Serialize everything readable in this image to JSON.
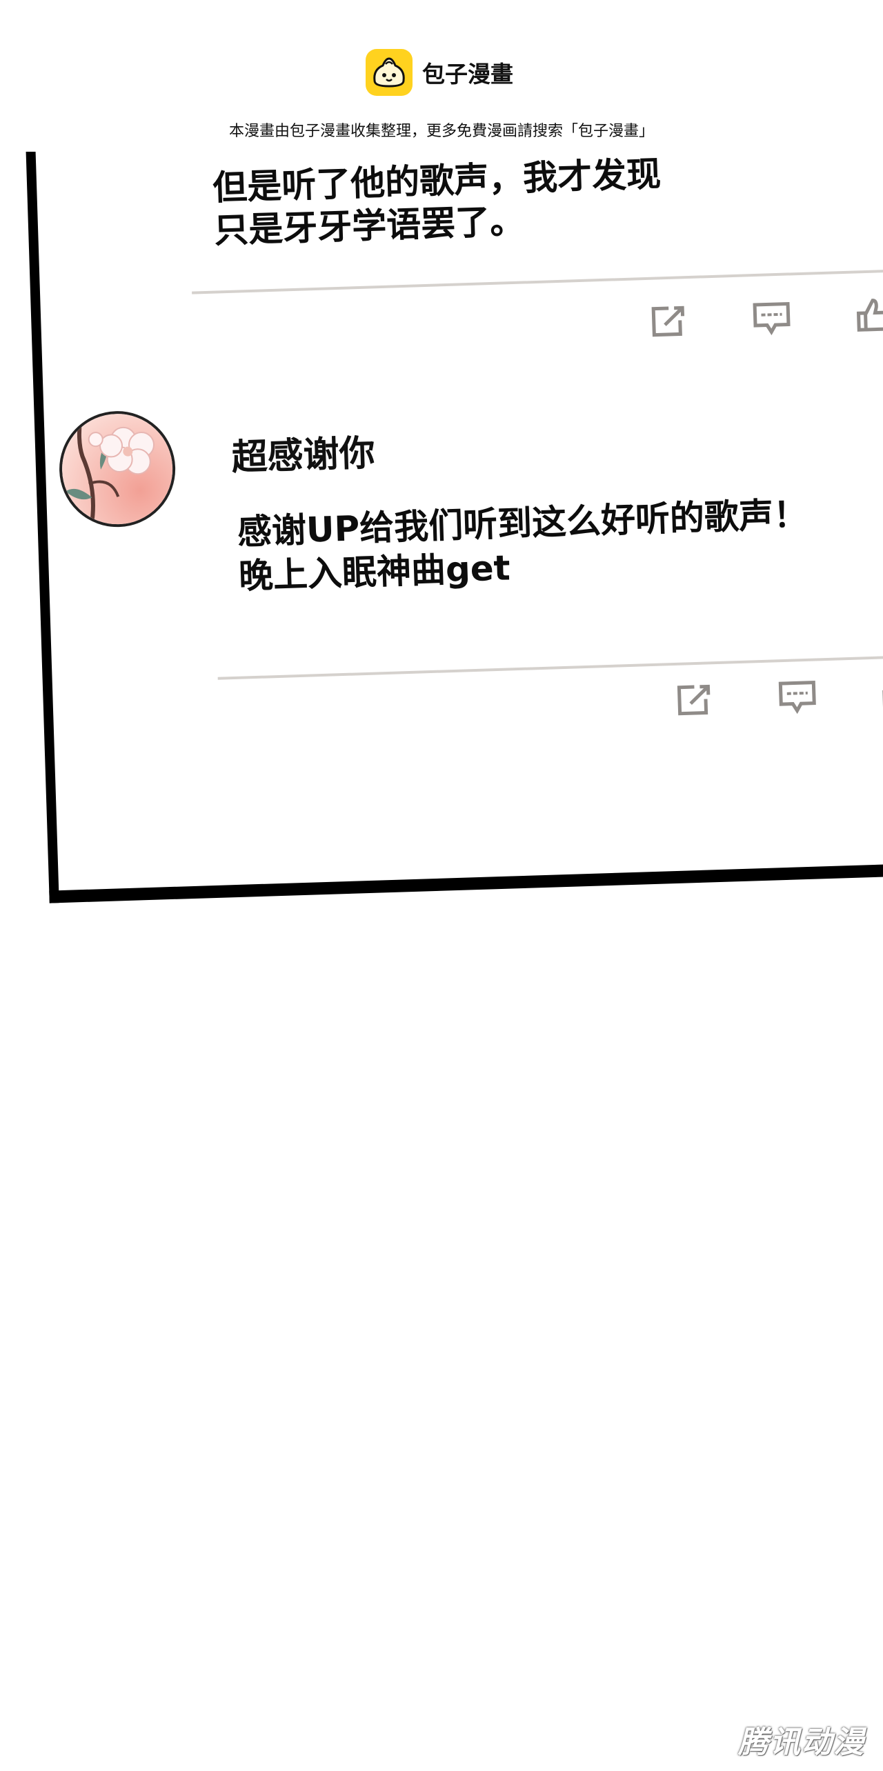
{
  "header": {
    "brand_name": "包子漫畫",
    "notice": "本漫畫由包子漫畫收集整理，更多免費漫画請搜索「包子漫畫」"
  },
  "comments": [
    {
      "lines": [
        "但是听了他的歌声，我才发现",
        "只是牙牙学语罢了。"
      ]
    },
    {
      "username": "超感谢你",
      "lines": [
        "感谢UP给我们听到这么好听的歌声！",
        "晚上入眠神曲get"
      ]
    }
  ],
  "actions": {
    "icons": [
      "edit-icon",
      "comment-icon",
      "thumbs-up-icon"
    ]
  },
  "colors": {
    "logo_bg": "#ffd21f",
    "divider": "#d5d1cd",
    "icon": "#8f8b88"
  },
  "watermark": "腾讯动漫"
}
